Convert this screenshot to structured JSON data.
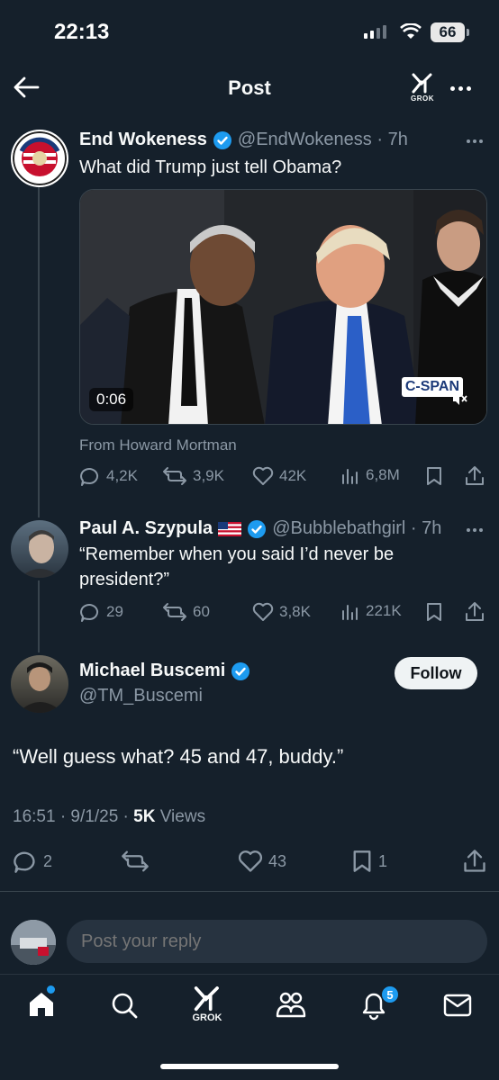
{
  "status_bar": {
    "time": "22:13",
    "battery": "66"
  },
  "header": {
    "title": "Post",
    "grok_label": "GROK"
  },
  "original_post": {
    "author_name": "End Wokeness",
    "handle_time": "@EndWokeness · 7h",
    "text": "What did Trump just tell Obama?",
    "media": {
      "duration": "0:06",
      "watermark": "C-SPAN"
    },
    "attribution": "From Howard Mortman",
    "stats": {
      "replies": "4,2K",
      "reposts": "3,9K",
      "likes": "42K",
      "views": "6,8M"
    }
  },
  "reply_post": {
    "author_name": "Paul A. Szypula",
    "handle_time": "@Bubblebathgirl · 7h",
    "text": "“Remember when you said I’d never be president?”",
    "stats": {
      "replies": "29",
      "reposts": "60",
      "likes": "3,8K",
      "views": "221K"
    }
  },
  "main_post": {
    "author_name": "Michael Buscemi",
    "handle": "@TM_Buscemi",
    "follow_label": "Follow",
    "text": "“Well guess what? 45 and 47, buddy.”",
    "timestamp": "16:51 · 9/1/25 · ",
    "views_count": "5K",
    "views_label": " Views",
    "stats": {
      "replies": "2",
      "reposts": "",
      "likes": "43",
      "bookmarks": "1"
    }
  },
  "composer": {
    "placeholder": "Post your reply"
  },
  "tab_bar": {
    "grok_label": "GROK",
    "notifications_count": "5"
  },
  "colors": {
    "background": "#15202b",
    "accent": "#1d9bf0",
    "muted": "#8b98a5"
  }
}
